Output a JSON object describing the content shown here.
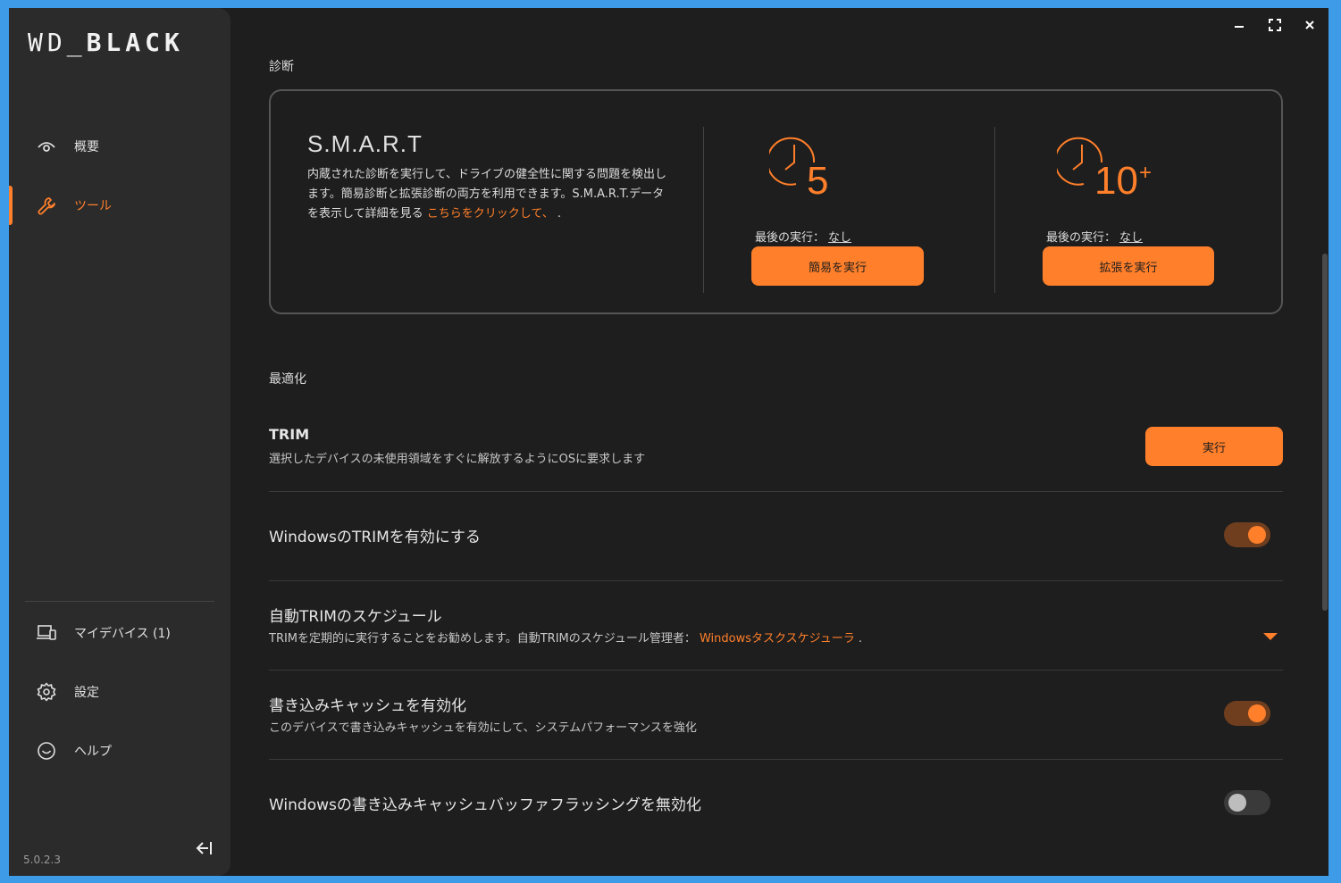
{
  "app": {
    "logo_left": "WD_",
    "logo_right": "BLACK",
    "version": "5.0.2.3"
  },
  "sidebar": {
    "items": [
      {
        "label": "概要",
        "icon": "eye-icon",
        "active": false
      },
      {
        "label": "ツール",
        "icon": "wrench-icon",
        "active": true
      },
      {
        "label": "マイデバイス (1)",
        "icon": "devices-icon",
        "active": false
      },
      {
        "label": "設定",
        "icon": "gear-icon",
        "active": false
      },
      {
        "label": "ヘルプ",
        "icon": "help-icon",
        "active": false
      }
    ]
  },
  "diagnostics": {
    "section_title": "診断",
    "smart_title": "S.M.A.R.T",
    "description": "内蔵された診断を実行して、ドライブの健全性に関する問題を検出します。簡易診断と拡張診断の両方を利用できます。S.M.A.R.T.データを表示して詳細を見る",
    "link_text": "こちらをクリックして、",
    "link_suffix": " .",
    "quick": {
      "minutes": "5",
      "last_run_label": "最後の実行：",
      "last_run_value": "なし",
      "button": "簡易を実行"
    },
    "extended": {
      "minutes": "10",
      "suffix": "+",
      "last_run_label": "最後の実行：",
      "last_run_value": "なし",
      "button": "拡張を実行"
    }
  },
  "optimize": {
    "section_title": "最適化",
    "trim": {
      "title": "TRIM",
      "desc": "選択したデバイスの未使用領域をすぐに解放するようにOSに要求します",
      "button": "実行"
    },
    "windows_trim": {
      "title": "WindowsのTRIMを有効にする",
      "enabled": true
    },
    "auto_trim": {
      "title": "自動TRIMのスケジュール",
      "desc": "TRIMを定期的に実行することをお勧めします。自動TRIMのスケジュール管理者：",
      "link": "Windowsタスクスケジューラ",
      "link_suffix": " ."
    },
    "write_cache": {
      "title": "書き込みキャッシュを有効化",
      "desc": "このデバイスで書き込みキャッシュを有効にして、システムパフォーマンスを強化",
      "enabled": true
    },
    "flush_disable": {
      "title": "Windowsの書き込みキャッシュバッファフラッシングを無効化",
      "enabled": false
    }
  },
  "colors": {
    "accent": "#ff7f2a",
    "bg": "#1e1e1e",
    "sidebar": "#2b2b2b"
  }
}
